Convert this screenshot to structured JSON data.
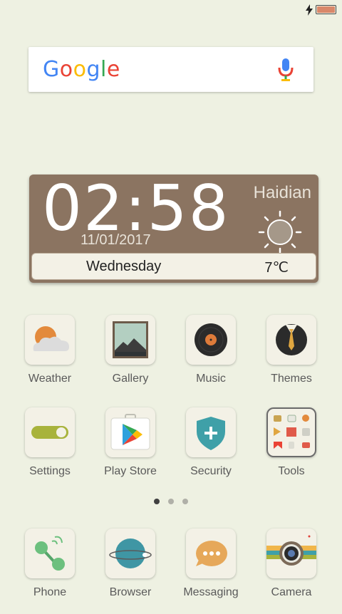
{
  "status": {
    "battery_level": 1.0,
    "charging": true
  },
  "search": {
    "logo_text": "Google"
  },
  "widget": {
    "time": "02:58",
    "date": "11/01/2017",
    "city": "Haidian",
    "day": "Wednesday",
    "temperature": "7℃"
  },
  "apps": [
    {
      "label": "Weather"
    },
    {
      "label": "Gallery"
    },
    {
      "label": "Music"
    },
    {
      "label": "Themes"
    },
    {
      "label": "Settings"
    },
    {
      "label": "Play Store"
    },
    {
      "label": "Security"
    },
    {
      "label": "Tools"
    }
  ],
  "dock": [
    {
      "label": "Phone"
    },
    {
      "label": "Browser"
    },
    {
      "label": "Messaging"
    },
    {
      "label": "Camera"
    }
  ],
  "pager": {
    "current_page": 1,
    "page_count": 3
  }
}
